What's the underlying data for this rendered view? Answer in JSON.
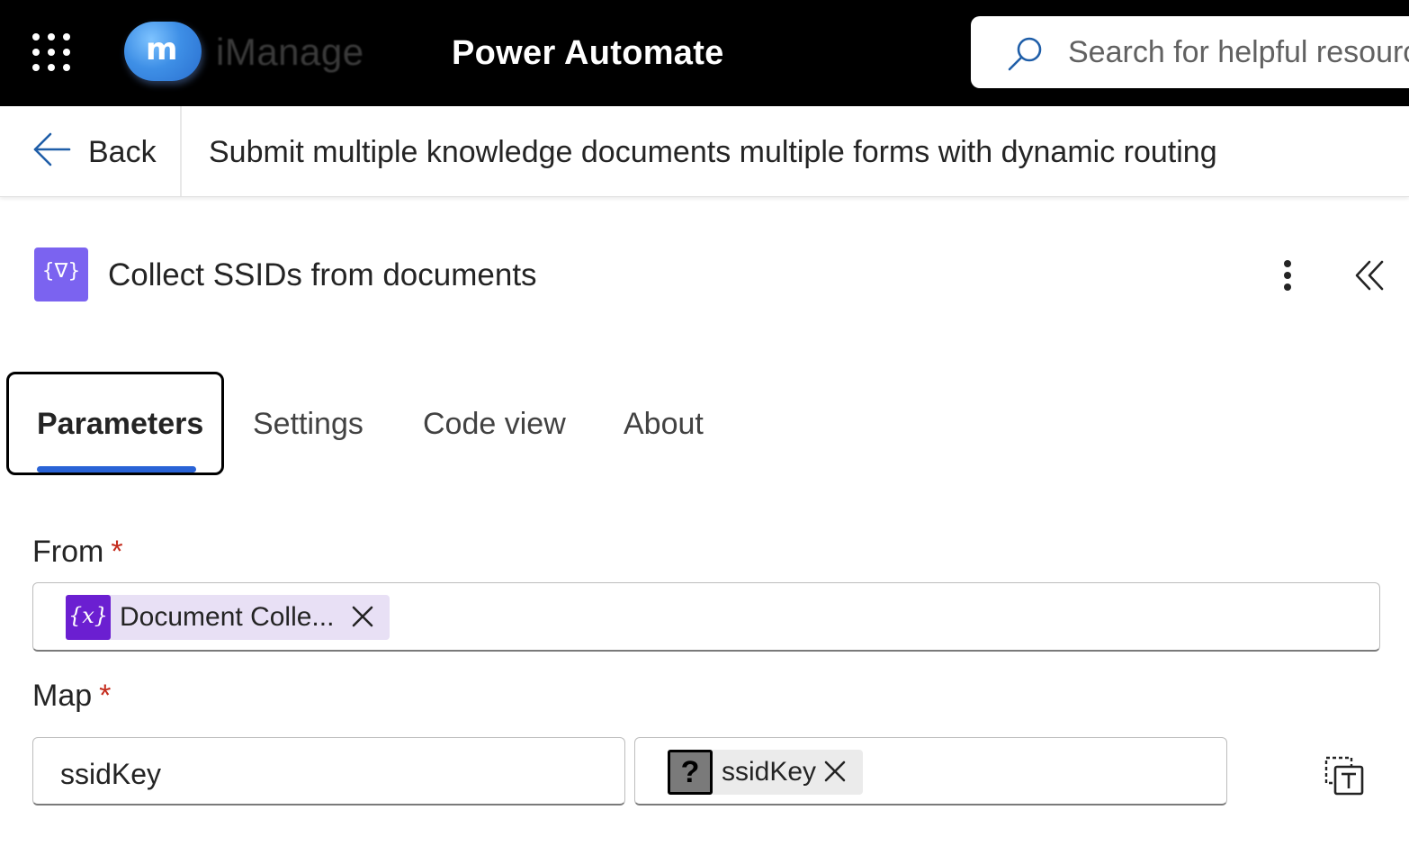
{
  "topbar": {
    "logo_text": "iManage",
    "logo_mark": "m",
    "app_title": "Power Automate",
    "search_placeholder": "Search for helpful resources",
    "background": "#000000"
  },
  "header": {
    "back_label": "Back",
    "flow_title": "Submit multiple knowledge documents multiple forms with dynamic routing"
  },
  "action": {
    "icon_glyph": "{∇}",
    "title": "Collect SSIDs from documents",
    "icon_color": "#7b63f0"
  },
  "tabs": [
    {
      "label": "Parameters",
      "active": true
    },
    {
      "label": "Settings",
      "active": false
    },
    {
      "label": "Code view",
      "active": false
    },
    {
      "label": "About",
      "active": false
    }
  ],
  "fields": {
    "from": {
      "label": "From",
      "required_mark": "*",
      "token": {
        "icon_glyph": "{x}",
        "text": "Document Colle...",
        "icon_color": "#6b1fd1",
        "bg": "#e8e0f5"
      }
    },
    "map": {
      "label": "Map",
      "required_mark": "*",
      "key_value": "ssidKey",
      "value_token": {
        "icon_glyph": "?",
        "text": "ssidKey"
      }
    }
  },
  "colors": {
    "accent_underline": "#2a63d6",
    "required": "#c42b1c"
  },
  "icons": [
    "waffle-icon",
    "search-icon",
    "back-arrow-icon",
    "more-vertical-icon",
    "collapse-panel-icon",
    "close-icon",
    "switch-to-text-mode-icon"
  ]
}
